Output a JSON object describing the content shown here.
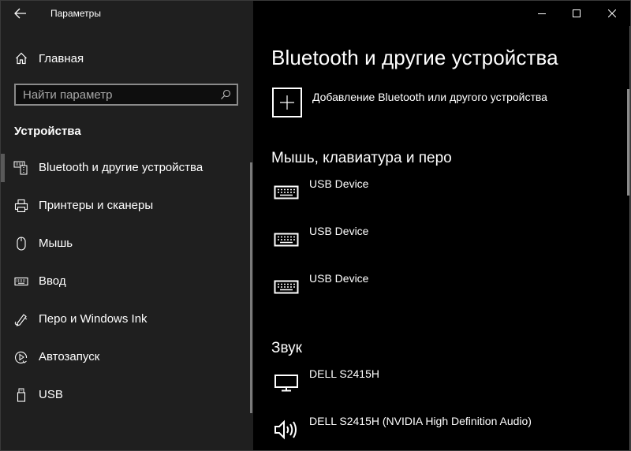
{
  "window": {
    "title": "Параметры",
    "controls": {
      "minimize": "minimize-icon",
      "maximize": "maximize-icon",
      "close": "close-icon"
    }
  },
  "sidebar": {
    "back_icon": "back-arrow-icon",
    "home": {
      "label": "Главная",
      "icon": "home-icon"
    },
    "search": {
      "placeholder": "Найти параметр",
      "value": "",
      "icon": "search-icon"
    },
    "section_title": "Устройства",
    "items": [
      {
        "label": "Bluetooth и другие устройства",
        "icon": "bluetooth-devices-icon",
        "selected": true
      },
      {
        "label": "Принтеры и сканеры",
        "icon": "printer-icon",
        "selected": false
      },
      {
        "label": "Мышь",
        "icon": "mouse-icon",
        "selected": false
      },
      {
        "label": "Ввод",
        "icon": "keyboard-icon",
        "selected": false
      },
      {
        "label": "Перо и Windows Ink",
        "icon": "pen-icon",
        "selected": false
      },
      {
        "label": "Автозапуск",
        "icon": "autoplay-icon",
        "selected": false
      },
      {
        "label": "USB",
        "icon": "usb-icon",
        "selected": false
      }
    ]
  },
  "main": {
    "title": "Bluetooth и другие устройства",
    "add_device": {
      "label": "Добавление Bluetooth или другого устройства",
      "icon": "plus-icon"
    },
    "groups": [
      {
        "title": "Мышь, клавиатура и перо",
        "devices": [
          {
            "name": "USB Device",
            "icon": "keyboard-icon"
          },
          {
            "name": "USB Device",
            "icon": "keyboard-icon"
          },
          {
            "name": "USB Device",
            "icon": "keyboard-icon"
          }
        ]
      },
      {
        "title": "Звук",
        "devices": [
          {
            "name": "DELL S2415H",
            "icon": "monitor-icon"
          },
          {
            "name": "DELL S2415H (NVIDIA High Definition Audio)",
            "icon": "speaker-icon"
          }
        ]
      }
    ]
  },
  "colors": {
    "sidebar_bg": "#1f1f1f",
    "main_bg": "#000000",
    "text": "#ffffff",
    "selected_indicator": "#5a5a5a"
  }
}
